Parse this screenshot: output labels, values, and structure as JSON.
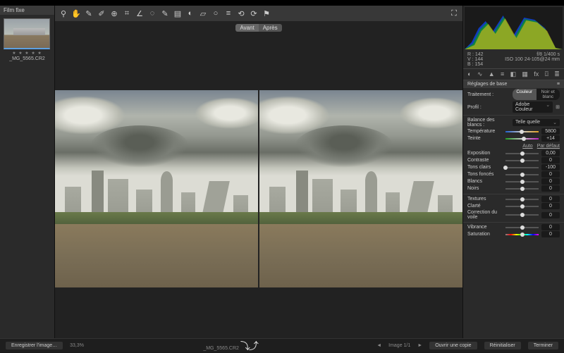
{
  "left": {
    "header": "Film fixe",
    "thumb_name": "_MG_5565.CR2",
    "stars": "★ ★ ★ ★ ★"
  },
  "toolbar": {
    "icons": [
      "zoom",
      "hand",
      "eyedrop-wb",
      "eyedrop-color",
      "target",
      "crop",
      "straighten",
      "spot",
      "redeye",
      "brush",
      "grad-linear",
      "grad-radial",
      "eraser",
      "circle",
      "rotate-left",
      "rotate-right",
      "flag"
    ],
    "fullscreen": "fullscreen"
  },
  "compare": {
    "before": "Avant",
    "after": "Après"
  },
  "meta": {
    "R": "R : 142",
    "V": "V : 144",
    "B": "B : 154",
    "aperture": "f/8",
    "shutter": "1/400 s",
    "iso": "ISO 100",
    "lens": "24-105@24 mm"
  },
  "panel": {
    "title": "Réglages de base",
    "treatment_label": "Traitement :",
    "treatment_color": "Couleur",
    "treatment_bw": "Noir et blanc",
    "profile_label": "Profil :",
    "profile_value": "Adobe Couleur",
    "wb_label": "Balance des blancs :",
    "wb_value": "Telle quelle",
    "auto": "Auto",
    "default": "Par défaut",
    "sliders": {
      "temperature": {
        "label": "Température",
        "value": "5800",
        "pos": 48
      },
      "tint": {
        "label": "Teinte",
        "value": "+14",
        "pos": 55
      },
      "exposure": {
        "label": "Exposition",
        "value": "0,00",
        "pos": 50
      },
      "contrast": {
        "label": "Contraste",
        "value": "0",
        "pos": 50
      },
      "highlights": {
        "label": "Tons clairs",
        "value": "-100",
        "pos": 0
      },
      "shadows": {
        "label": "Tons foncés",
        "value": "0",
        "pos": 50
      },
      "whites": {
        "label": "Blancs",
        "value": "0",
        "pos": 50
      },
      "blacks": {
        "label": "Noirs",
        "value": "0",
        "pos": 50
      },
      "texture": {
        "label": "Textures",
        "value": "0",
        "pos": 50
      },
      "clarity": {
        "label": "Clarté",
        "value": "0",
        "pos": 50
      },
      "dehaze": {
        "label": "Correction du voile",
        "value": "0",
        "pos": 50
      },
      "vibrance": {
        "label": "Vibrance",
        "value": "0",
        "pos": 50
      },
      "saturation": {
        "label": "Saturation",
        "value": "0",
        "pos": 50
      }
    }
  },
  "footer": {
    "save_image": "Enregistrer l'image…",
    "zoom": "33,3%",
    "filename": "_MG_5565.CR2",
    "nav_prev": "◄",
    "image_counter": "Image 1/1",
    "nav_next": "►",
    "open_copy": "Ouvrir une copie",
    "reset": "Réinitialiser",
    "done": "Terminer"
  }
}
